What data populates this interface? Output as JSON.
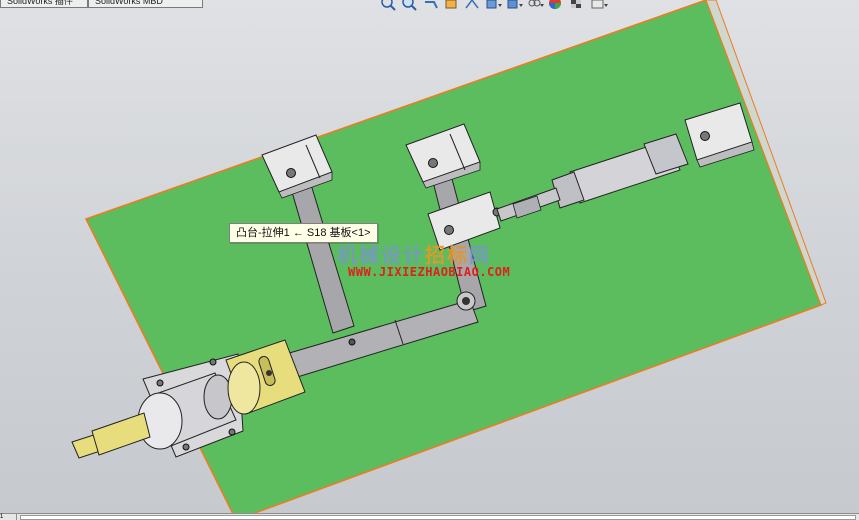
{
  "tabs": [
    {
      "label": "SolidWorks 插件"
    },
    {
      "label": "SolidWorks MBD"
    }
  ],
  "view_toolbar": {
    "buttons": [
      {
        "icon": "zoom-to-fit-icon"
      },
      {
        "icon": "zoom-to-area-icon"
      },
      {
        "icon": "previous-view-icon"
      },
      {
        "icon": "section-view-icon"
      },
      {
        "icon": "dynamic-annotation-icon"
      },
      {
        "icon": "view-orientation-icon"
      },
      {
        "icon": "display-style-icon"
      },
      {
        "icon": "hide-show-items-icon"
      },
      {
        "icon": "edit-appearance-icon"
      },
      {
        "icon": "apply-scene-icon"
      },
      {
        "icon": "view-settings-icon"
      }
    ]
  },
  "tooltip": {
    "text": "凸台-拉伸1 ← S18 基板<1>"
  },
  "watermark": {
    "cn_part1": "机械设计",
    "cn_part2": "招标",
    "cn_part3": "网",
    "url": "WWW.JIXIEZHAOBIAO.COM"
  },
  "status_bar": {
    "cell": "1"
  },
  "colors": {
    "plate": "#5cbd5f",
    "plate_edge": "#f07a20",
    "bracket": "#e9e9ea",
    "link": "#a7a7ab",
    "brass": "#e8dd7d",
    "cylinder": "#d3d3d8"
  }
}
